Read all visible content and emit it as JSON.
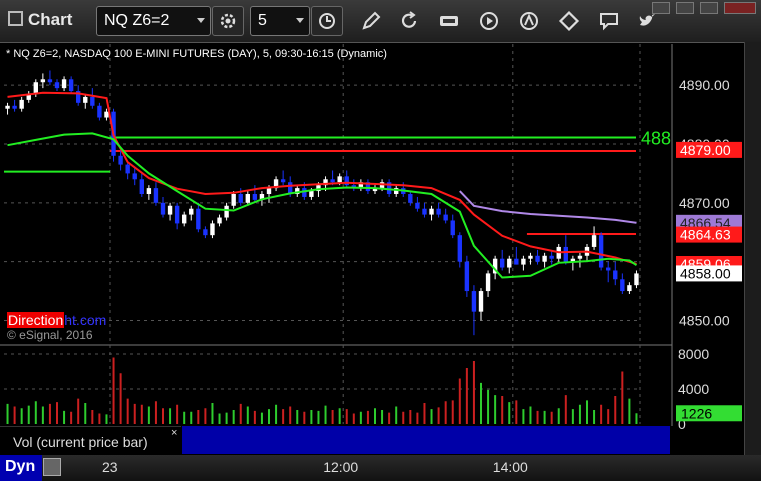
{
  "app": {
    "title": "Chart"
  },
  "toolbar": {
    "symbol": "NQ Z6=2",
    "interval": "5"
  },
  "chart_info": "* NQ Z6=2, NASDAQ 100 E-MINI FUTURES (DAY), 5, 09:30-16:15 (Dynamic)",
  "brand": {
    "part1": "Direction",
    "part2": "ht.com"
  },
  "copyright": "© eSignal, 2016",
  "volume_panel": {
    "label": "Vol (current price bar)",
    "close": "×"
  },
  "bottom": {
    "mode": "Dyn"
  },
  "colors": {
    "up": "#ffffff",
    "down": "#1a33ff",
    "ma_green": "#22ee22",
    "ma_red": "#ff1a1a",
    "ma_purple": "#b088e8",
    "vol_up": "#2ecc2e",
    "vol_down": "#cc2020"
  },
  "chart_data": {
    "type": "candlestick",
    "title": "NQ Z6=2, NASDAQ 100 E-MINI FUTURES (DAY), 5, 09:30-16:15 (Dynamic)",
    "price_ticks": [
      "4890.00",
      "4880.00",
      "4870.00",
      "4860.00",
      "4850.00"
    ],
    "price_tick_values": [
      4890,
      4880,
      4870,
      4860,
      4850
    ],
    "ylim": [
      4846,
      4897
    ],
    "time_ticks": [
      {
        "label": "23",
        "index": 15
      },
      {
        "label": "12:00",
        "index": 48
      },
      {
        "label": "14:00",
        "index": 72
      }
    ],
    "price_labels": [
      {
        "text": "4879.00",
        "value": 4879,
        "bg": "#ff1a1a",
        "fg": "#ffffff"
      },
      {
        "text": "4866.54",
        "value": 4866.6,
        "bg": "#9e7ad6",
        "fg": "#222222"
      },
      {
        "text": "4864.63",
        "value": 4864.6,
        "bg": "#ff1a1a",
        "fg": "#ffffff"
      },
      {
        "text": "4859.06",
        "value": 4859.6,
        "bg": "#ff1a1a",
        "fg": "#ffffff"
      },
      {
        "text": "4858.00",
        "value": 4858,
        "bg": "#ffffff",
        "fg": "#000000"
      }
    ],
    "cut_label": {
      "text": "488",
      "value": 4881.1
    },
    "levels": [
      {
        "name": "green-level-1",
        "value": 4881.1,
        "from": 15,
        "color": "#22ee22"
      },
      {
        "name": "green-level-2",
        "value": 4875.3,
        "from": 0,
        "to": 15,
        "color": "#22ee22"
      },
      {
        "name": "red-level-1",
        "value": 4878.8,
        "from": 15,
        "color": "#ff1a1a"
      },
      {
        "name": "red-level-2",
        "value": 4864.7,
        "from": 74,
        "color": "#ff1a1a"
      }
    ],
    "candles": [
      [
        4886,
        4887,
        4885,
        4886.5
      ],
      [
        4886.5,
        4887.5,
        4885.5,
        4886
      ],
      [
        4886,
        4888,
        4885.5,
        4887.5
      ],
      [
        4887.5,
        4889,
        4887,
        4888.5
      ],
      [
        4888.5,
        4891,
        4888,
        4890.5
      ],
      [
        4890.5,
        4892,
        4889.5,
        4891
      ],
      [
        4891,
        4892.5,
        4890,
        4890.5
      ],
      [
        4890.5,
        4891,
        4889,
        4889.5
      ],
      [
        4889.5,
        4891.5,
        4889,
        4891
      ],
      [
        4891,
        4891.5,
        4888.5,
        4889
      ],
      [
        4889,
        4890,
        4886.5,
        4887
      ],
      [
        4887,
        4888.5,
        4886,
        4888
      ],
      [
        4888,
        4889.5,
        4886,
        4886.5
      ],
      [
        4886.5,
        4887,
        4884,
        4884.5
      ],
      [
        4884.5,
        4886,
        4884,
        4885.5
      ],
      [
        4885.5,
        4886,
        4877,
        4878
      ],
      [
        4878,
        4879,
        4875.5,
        4876.5
      ],
      [
        4876.5,
        4877,
        4874,
        4875
      ],
      [
        4875,
        4876,
        4873,
        4874
      ],
      [
        4874,
        4875,
        4871,
        4871.5
      ],
      [
        4871.5,
        4873,
        4870.5,
        4872.5
      ],
      [
        4872.5,
        4873.5,
        4869.5,
        4870
      ],
      [
        4870,
        4871,
        4867.5,
        4868
      ],
      [
        4868,
        4870,
        4867,
        4869.5
      ],
      [
        4869.5,
        4870,
        4865.5,
        4866.5
      ],
      [
        4866.5,
        4868.5,
        4866,
        4868
      ],
      [
        4868,
        4869.5,
        4867,
        4869
      ],
      [
        4869,
        4870,
        4865,
        4865.5
      ],
      [
        4865.5,
        4866,
        4864,
        4864.5
      ],
      [
        4864.5,
        4867,
        4864,
        4866.5
      ],
      [
        4866.5,
        4868,
        4866,
        4867.5
      ],
      [
        4867.5,
        4870,
        4867,
        4869.5
      ],
      [
        4869.5,
        4872,
        4869,
        4871.5
      ],
      [
        4871.5,
        4872.5,
        4869.5,
        4870
      ],
      [
        4870,
        4872,
        4869.5,
        4871.5
      ],
      [
        4871.5,
        4873,
        4870,
        4870.5
      ],
      [
        4870.5,
        4872,
        4869.5,
        4871.5
      ],
      [
        4871.5,
        4873,
        4870,
        4872.5
      ],
      [
        4872.5,
        4874.5,
        4872,
        4874
      ],
      [
        4874,
        4875.5,
        4873,
        4873.5
      ],
      [
        4873.5,
        4874.5,
        4871,
        4871.5
      ],
      [
        4871.5,
        4873,
        4871,
        4872.5
      ],
      [
        4872.5,
        4873.5,
        4870.5,
        4871
      ],
      [
        4871,
        4872.5,
        4870.5,
        4872
      ],
      [
        4872,
        4873.5,
        4871,
        4873
      ],
      [
        4873,
        4874.5,
        4872,
        4874
      ],
      [
        4874,
        4875.5,
        4873,
        4873.5
      ],
      [
        4873.5,
        4875,
        4873,
        4874.5
      ],
      [
        4874.5,
        4875.5,
        4872.5,
        4873
      ],
      [
        4873,
        4874,
        4872,
        4872.5
      ],
      [
        4872.5,
        4874,
        4872,
        4873.5
      ],
      [
        4873.5,
        4874,
        4871.5,
        4872
      ],
      [
        4872,
        4873,
        4871.5,
        4872.5
      ],
      [
        4872.5,
        4874,
        4872,
        4873.5
      ],
      [
        4873.5,
        4874,
        4871,
        4871.5
      ],
      [
        4871.5,
        4873,
        4871,
        4872.5
      ],
      [
        4872.5,
        4873.5,
        4871,
        4871.5
      ],
      [
        4871.5,
        4872,
        4869.5,
        4870
      ],
      [
        4870,
        4871,
        4868.5,
        4869
      ],
      [
        4869,
        4870,
        4867.5,
        4868
      ],
      [
        4868,
        4869.5,
        4867,
        4869
      ],
      [
        4869,
        4870,
        4867.5,
        4868
      ],
      [
        4868,
        4869,
        4866.5,
        4867
      ],
      [
        4867,
        4868,
        4864,
        4864.5
      ],
      [
        4864.5,
        4865,
        4859,
        4860
      ],
      [
        4860,
        4861,
        4854,
        4855
      ],
      [
        4855,
        4856,
        4847.5,
        4851.5
      ],
      [
        4851.5,
        4855.5,
        4850,
        4855
      ],
      [
        4855,
        4858.5,
        4854,
        4858
      ],
      [
        4858,
        4861,
        4857,
        4860.5
      ],
      [
        4860.5,
        4862,
        4858.5,
        4859
      ],
      [
        4859,
        4861,
        4858,
        4860.5
      ],
      [
        4860.5,
        4862.5,
        4859.5,
        4859.5
      ],
      [
        4859.5,
        4861,
        4858.5,
        4860.5
      ],
      [
        4860.5,
        4861.5,
        4859.5,
        4861
      ],
      [
        4861,
        4862,
        4859.5,
        4860
      ],
      [
        4860,
        4861.5,
        4859,
        4861
      ],
      [
        4861,
        4862,
        4859.5,
        4860.5
      ],
      [
        4860.5,
        4863,
        4860,
        4862.5
      ],
      [
        4862.5,
        4864.5,
        4859.5,
        4860
      ],
      [
        4860,
        4861,
        4858.5,
        4860.5
      ],
      [
        4860.5,
        4861.5,
        4859,
        4861
      ],
      [
        4861,
        4863,
        4860,
        4862.5
      ],
      [
        4862.5,
        4866,
        4862,
        4864.5
      ],
      [
        4864.5,
        4865,
        4858.5,
        4859
      ],
      [
        4859,
        4860,
        4856.5,
        4858.5
      ],
      [
        4858.5,
        4860,
        4856,
        4857
      ],
      [
        4857,
        4858,
        4854.5,
        4855
      ],
      [
        4855,
        4856.5,
        4854.5,
        4856
      ],
      [
        4856,
        4858.5,
        4855.5,
        4858
      ]
    ],
    "ma_green": [
      [
        0,
        4879.8
      ],
      [
        4,
        4880.7
      ],
      [
        8,
        4881.6
      ],
      [
        12,
        4881.8
      ],
      [
        15,
        4880.8
      ],
      [
        17,
        4878
      ],
      [
        20,
        4875
      ],
      [
        24,
        4872
      ],
      [
        28,
        4869
      ],
      [
        32,
        4868.7
      ],
      [
        36,
        4870.6
      ],
      [
        40,
        4871.6
      ],
      [
        44,
        4872.3
      ],
      [
        48,
        4872.6
      ],
      [
        52,
        4872.5
      ],
      [
        56,
        4872.1
      ],
      [
        60,
        4871.5
      ],
      [
        64,
        4868.5
      ],
      [
        66,
        4862.7
      ],
      [
        70,
        4857.3
      ],
      [
        74,
        4857.6
      ],
      [
        78,
        4859.8
      ],
      [
        82,
        4860.1
      ],
      [
        85,
        4860.5
      ],
      [
        88,
        4860.2
      ],
      [
        89,
        4859.4
      ]
    ],
    "ma_red": [
      [
        0,
        4888
      ],
      [
        5,
        4888.7
      ],
      [
        10,
        4888.6
      ],
      [
        14,
        4887.8
      ],
      [
        15,
        4881.5
      ],
      [
        17,
        4876.9
      ],
      [
        20,
        4874.2
      ],
      [
        24,
        4872.4
      ],
      [
        28,
        4871.5
      ],
      [
        32,
        4871.7
      ],
      [
        36,
        4872.5
      ],
      [
        40,
        4872.9
      ],
      [
        48,
        4873.4
      ],
      [
        56,
        4873
      ],
      [
        60,
        4872.5
      ],
      [
        64,
        4870.5
      ],
      [
        66,
        4868
      ],
      [
        70,
        4864.4
      ],
      [
        74,
        4862.6
      ],
      [
        78,
        4861.6
      ],
      [
        82,
        4861.7
      ],
      [
        86,
        4860.7
      ],
      [
        89,
        4859.6
      ]
    ],
    "ma_purple": [
      [
        64,
        4872
      ],
      [
        66,
        4869.5
      ],
      [
        70,
        4868.6
      ],
      [
        74,
        4868.1
      ],
      [
        78,
        4867.8
      ],
      [
        82,
        4867.5
      ],
      [
        86,
        4867.1
      ],
      [
        89,
        4866.6
      ]
    ],
    "volume": {
      "ticks": [
        "8000",
        "4000",
        "0"
      ],
      "tick_values": [
        8000,
        4000,
        0
      ],
      "ylim": [
        0,
        8800
      ],
      "current": "1226",
      "values": [
        2300,
        2000,
        1800,
        2100,
        2600,
        2000,
        2300,
        2500,
        1500,
        1400,
        2900,
        2400,
        1600,
        1200,
        1100,
        7600,
        5800,
        2900,
        2300,
        2200,
        2000,
        2600,
        1800,
        1800,
        2200,
        1400,
        1400,
        1600,
        1800,
        2400,
        1200,
        1300,
        1600,
        2300,
        2000,
        1500,
        1300,
        1700,
        2200,
        1700,
        2000,
        1600,
        1400,
        1600,
        1500,
        2100,
        1600,
        1800,
        1700,
        1200,
        1400,
        1500,
        1800,
        1600,
        1300,
        2000,
        1400,
        1600,
        1300,
        2400,
        1700,
        1900,
        2600,
        2700,
        5200,
        6400,
        7200,
        4700,
        3900,
        3300,
        3200,
        2500,
        2700,
        1700,
        2000,
        1500,
        1500,
        1400,
        1800,
        3300,
        1700,
        2200,
        2700,
        1600,
        2200,
        1700,
        3200,
        6000,
        2900,
        1226
      ]
    }
  }
}
